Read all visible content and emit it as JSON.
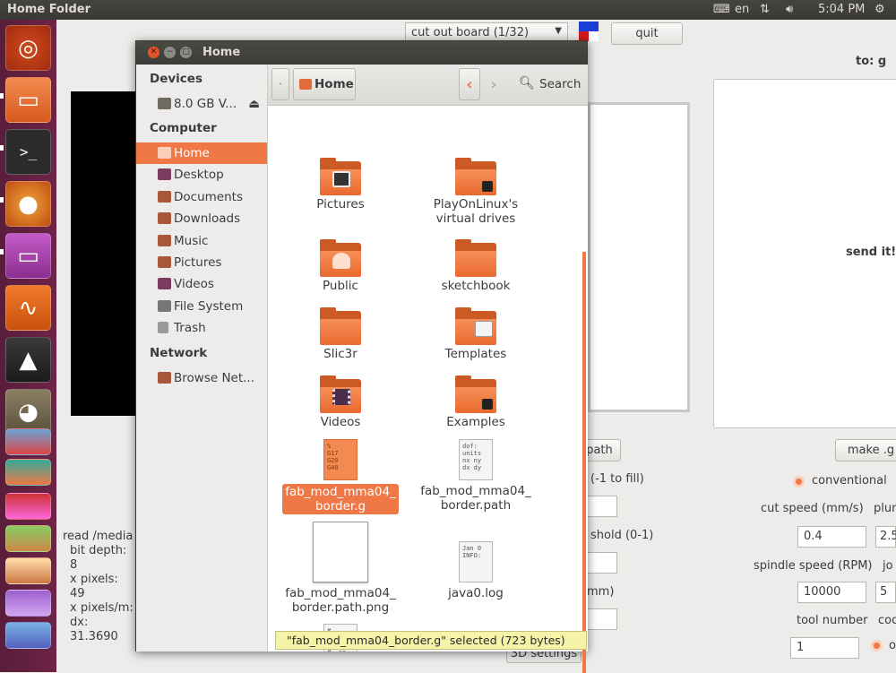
{
  "top_panel": {
    "window_title": "Home Folder",
    "keyboard_layout": "en",
    "time": "5:04 PM"
  },
  "launcher": {
    "items": [
      "ubuntu-dash",
      "files",
      "terminal",
      "firefox",
      "display",
      "app-orange",
      "inkscape",
      "gimp",
      "misc"
    ]
  },
  "bg_app": {
    "mode_select": "cut out board (1/32)",
    "quit_label": "quit",
    "to_label": "to: g",
    "send_label": "send it!",
    "path_label": "path",
    "make_g_label": "make .g",
    "conventional_label": "conventional",
    "fill_label": "(-1 to fill)",
    "threshold_label": "shold (0-1)",
    "mm_label": "mm)",
    "cut_speed_label": "cut speed (mm/s)",
    "plunge_label": "plun",
    "cut_speed_value": "0.4",
    "plunge_value": "2.5",
    "spindle_label": "spindle speed (RPM)",
    "jog_label": "jo",
    "spindle_value": "10000",
    "jog_value": "5",
    "tool_number_label": "tool number",
    "coolant_label": "coo",
    "tool_number_value": "1",
    "radio2_label": "o",
    "settings3d_label": "3D settings",
    "info_lines": [
      "read /media",
      "bit depth: 8",
      "x pixels: 49",
      "x pixels/m:",
      "dx: 31.3690"
    ]
  },
  "dialog": {
    "title": "Home",
    "sidebar": {
      "devices_heading": "Devices",
      "devices": [
        {
          "label": "8.0 GB V...",
          "icon": "usb-drive-icon"
        }
      ],
      "computer_heading": "Computer",
      "computer": [
        {
          "label": "Home",
          "icon": "home-icon",
          "color": "#e36a3b"
        },
        {
          "label": "Desktop",
          "icon": "desktop-icon",
          "color": "#7b3b5f"
        },
        {
          "label": "Documents",
          "icon": "documents-icon",
          "color": "#a9573a"
        },
        {
          "label": "Downloads",
          "icon": "downloads-icon",
          "color": "#a9573a"
        },
        {
          "label": "Music",
          "icon": "music-icon",
          "color": "#a9573a"
        },
        {
          "label": "Pictures",
          "icon": "pictures-icon",
          "color": "#a9573a"
        },
        {
          "label": "Videos",
          "icon": "videos-icon",
          "color": "#7b3b5f"
        },
        {
          "label": "File System",
          "icon": "harddisk-icon",
          "color": "#777777"
        },
        {
          "label": "Trash",
          "icon": "trash-icon",
          "color": "#9a9a9a"
        }
      ],
      "network_heading": "Network",
      "network": [
        {
          "label": "Browse Net...",
          "icon": "network-icon"
        }
      ]
    },
    "toolbar": {
      "location": "Home",
      "search_label": "Search"
    },
    "files": [
      {
        "label": "Pictures",
        "kind": "folder",
        "emblem": "pictures"
      },
      {
        "label": "PlayOnLinux's virtual drives",
        "kind": "folder",
        "emblem": "link"
      },
      {
        "label": "Public",
        "kind": "folder",
        "emblem": "public"
      },
      {
        "label": "sketchbook",
        "kind": "folder",
        "emblem": ""
      },
      {
        "label": "Slic3r",
        "kind": "folder",
        "emblem": ""
      },
      {
        "label": "Templates",
        "kind": "folder",
        "emblem": "templates"
      },
      {
        "label": "Videos",
        "kind": "folder",
        "emblem": "videos"
      },
      {
        "label": "Examples",
        "kind": "folder",
        "emblem": "link"
      },
      {
        "label": "fab_mod_mma04_ border.g",
        "kind": "gcode",
        "preview": "%\nG17\nG20\nG40",
        "selected": true
      },
      {
        "label": "fab_mod_mma04_ border.path",
        "kind": "text",
        "preview": "dof:\nunits\nnx ny\ndx dy"
      },
      {
        "label": "fab_mod_mma04_ border.path.png",
        "kind": "image",
        "preview": ""
      },
      {
        "label": "java0.log",
        "kind": "text",
        "preview": "Jan 0\nINFO:"
      },
      {
        "label": "",
        "kind": "text",
        "preview": "#\n# pcb\n#\n# .ca"
      }
    ],
    "status": "\"fab_mod_mma04_border.g\" selected (723 bytes)"
  }
}
